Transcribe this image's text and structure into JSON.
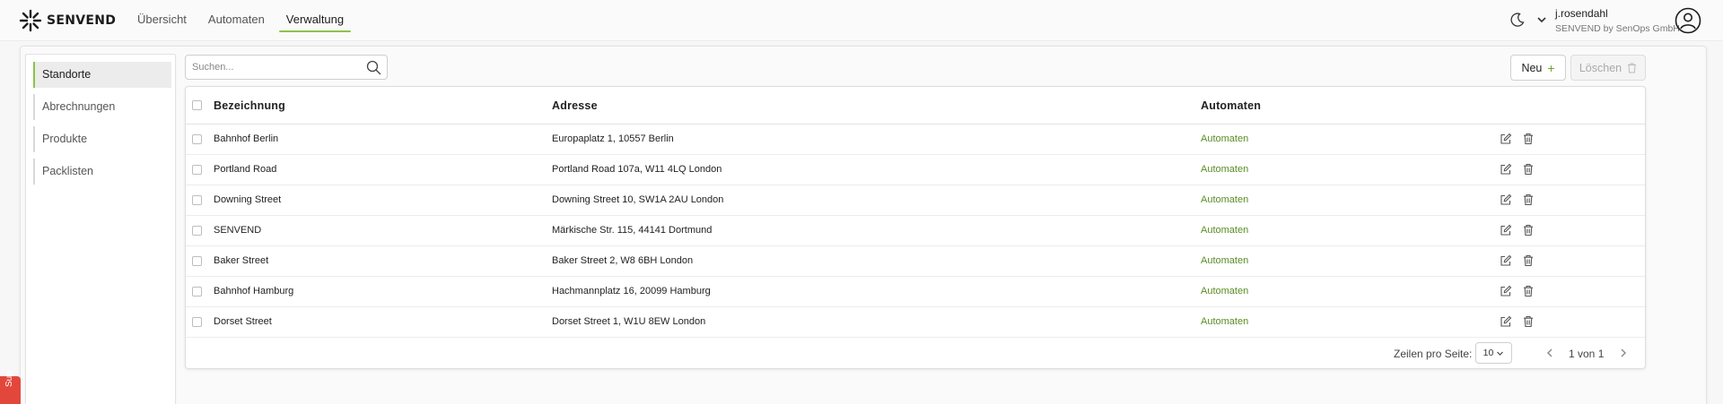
{
  "brand": {
    "name": "SENVEND"
  },
  "nav": {
    "items": [
      {
        "label": "Übersicht"
      },
      {
        "label": "Automaten"
      },
      {
        "label": "Verwaltung"
      }
    ]
  },
  "user": {
    "name": "j.rosendahl",
    "company": "SENVEND by SenOps GmbH"
  },
  "sidebar": {
    "items": [
      {
        "label": "Standorte"
      },
      {
        "label": "Abrechnungen"
      },
      {
        "label": "Produkte"
      },
      {
        "label": "Packlisten"
      }
    ]
  },
  "search": {
    "placeholder": "Suchen..."
  },
  "toolbar": {
    "new_label": "Neu",
    "delete_label": "Löschen"
  },
  "table": {
    "columns": [
      "Bezeichnung",
      "Adresse",
      "Automaten"
    ],
    "rows": [
      {
        "name": "Bahnhof Berlin",
        "address": "Europaplatz 1, 10557 Berlin",
        "machines": "Automaten"
      },
      {
        "name": "Portland Road",
        "address": "Portland Road 107a, W11 4LQ London",
        "machines": "Automaten"
      },
      {
        "name": "Downing Street",
        "address": "Downing Street 10, SW1A 2AU London",
        "machines": "Automaten"
      },
      {
        "name": "SENVEND",
        "address": "Märkische Str. 115, 44141 Dortmund",
        "machines": "Automaten"
      },
      {
        "name": "Baker Street",
        "address": "Baker Street 2, W8 6BH London",
        "machines": "Automaten"
      },
      {
        "name": "Bahnhof Hamburg",
        "address": "Hachmannplatz 16, 20099 Hamburg",
        "machines": "Automaten"
      },
      {
        "name": "Dorset Street",
        "address": "Dorset Street 1, W1U 8EW London",
        "machines": "Automaten"
      }
    ]
  },
  "pagination": {
    "rows_per_page_label": "Zeilen pro Seite:",
    "rows_per_page": "10",
    "page_info": "1 von 1"
  },
  "support_tab": {
    "label": "Sup"
  },
  "colors": {
    "accent": "#8bc34a",
    "link": "#5a8c25",
    "support": "#e3473c"
  },
  "icons": [
    "logo-icon",
    "moon-icon",
    "chevron-down-icon",
    "user-avatar-icon",
    "search-icon",
    "plus-icon",
    "trash-icon",
    "edit-icon",
    "chevron-left-icon",
    "chevron-right-icon"
  ]
}
